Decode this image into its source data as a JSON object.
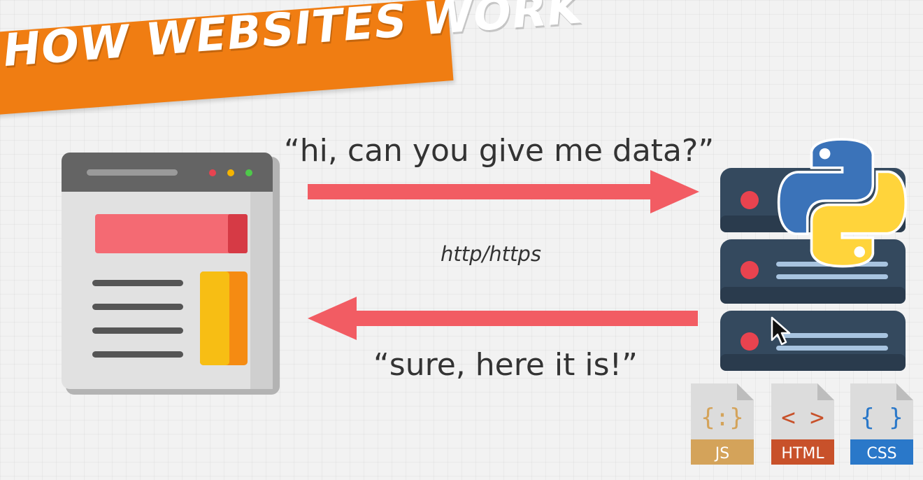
{
  "banner": {
    "title": "HOW WEBSITES WORK"
  },
  "messages": {
    "request": "“hi, can you give me data?”",
    "protocol": "http/https",
    "response": "“sure, here it is!”"
  },
  "files": [
    {
      "label": "JS",
      "glyph": "{:}",
      "color": "#d4a35a"
    },
    {
      "label": "HTML",
      "glyph": "< >",
      "color": "#c8512a"
    },
    {
      "label": "CSS",
      "glyph": "{ }",
      "color": "#2a78c9"
    }
  ],
  "colors": {
    "banner": "#f07d12",
    "arrow": "#f25c63",
    "server": "#34495e",
    "server_led": "#e8434f",
    "python_blue": "#3b73b9",
    "python_yellow": "#ffd43b"
  },
  "icons": {
    "browser": "browser-window-icon",
    "server": "server-rack-icon",
    "python": "python-logo-icon",
    "cursor": "mouse-cursor-icon"
  }
}
